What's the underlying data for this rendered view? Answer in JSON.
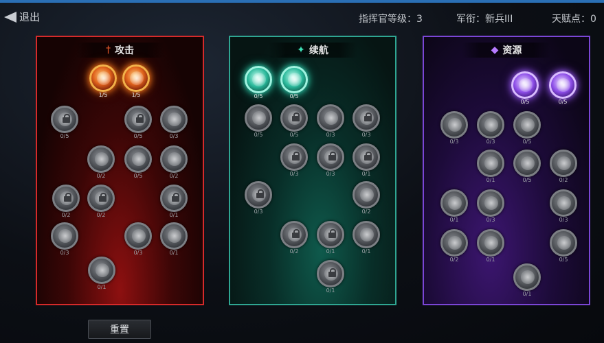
{
  "header": {
    "back_label": "退出",
    "commander_level": "指挥官等级：3",
    "rank": "军衔：新兵III",
    "talent_points": "天赋点：0"
  },
  "panels": {
    "attack": {
      "title": "攻击",
      "icon": "sword-icon",
      "accent": "#d62a2a"
    },
    "endure": {
      "title": "续航",
      "icon": "sparkle-icon",
      "accent": "#2fa692"
    },
    "resource": {
      "title": "资源",
      "icon": "crystal-icon",
      "accent": "#7b46d6"
    }
  },
  "nodes": {
    "attack": [
      "1/5",
      "1/5",
      "0/5",
      "0/5",
      "0/3",
      "0/2",
      "0/5",
      "0/2",
      "0/2",
      "0/2",
      "0/1",
      "0/3",
      "0/3",
      "0/1",
      "0/1"
    ],
    "endure": [
      "0/5",
      "0/5",
      "0/5",
      "0/5",
      "0/3",
      "0/3",
      "0/3",
      "0/3",
      "0/1",
      "0/3",
      "0/2",
      "0/2",
      "0/1",
      "0/1",
      "0/1"
    ],
    "resource": [
      "0/5",
      "0/5",
      "0/3",
      "0/3",
      "0/5",
      "0/1",
      "0/5",
      "0/2",
      "0/1",
      "0/3",
      "0/3",
      "0/2",
      "0/1",
      "0/5",
      "0/1"
    ]
  },
  "reset_label": "重置"
}
